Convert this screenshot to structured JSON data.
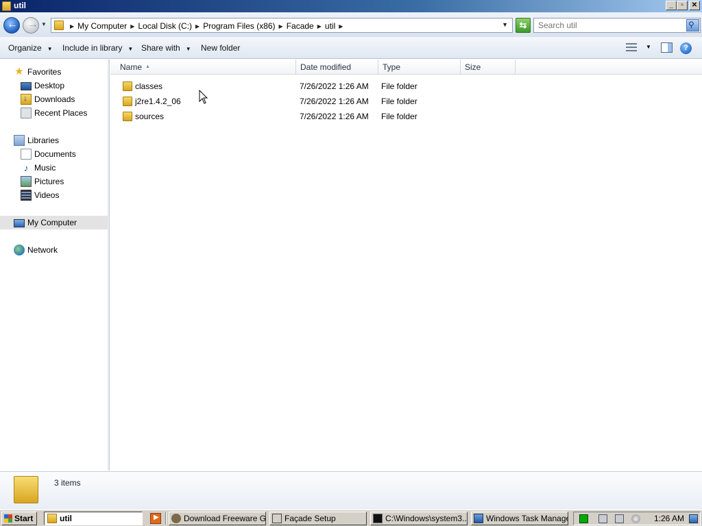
{
  "window": {
    "title": "util",
    "minimize": "_",
    "restore": "▫",
    "close": "✕"
  },
  "address": {
    "breadcrumbs": [
      "My Computer",
      "Local Disk (C:)",
      "Program Files (x86)",
      "Facade",
      "util"
    ],
    "search_placeholder": "Search util"
  },
  "commands": {
    "organize": "Organize",
    "include_in_library": "Include in library",
    "share_with": "Share with",
    "new_folder": "New folder"
  },
  "nav": {
    "favorites": "Favorites",
    "desktop": "Desktop",
    "downloads": "Downloads",
    "recent_places": "Recent Places",
    "libraries": "Libraries",
    "documents": "Documents",
    "music": "Music",
    "pictures": "Pictures",
    "videos": "Videos",
    "my_computer": "My Computer",
    "network": "Network"
  },
  "columns": {
    "name": "Name",
    "date_modified": "Date modified",
    "type": "Type",
    "size": "Size"
  },
  "files": [
    {
      "name": "classes",
      "date": "7/26/2022 1:26 AM",
      "type": "File folder",
      "size": ""
    },
    {
      "name": "j2re1.4.2_06",
      "date": "7/26/2022 1:26 AM",
      "type": "File folder",
      "size": ""
    },
    {
      "name": "sources",
      "date": "7/26/2022 1:26 AM",
      "type": "File folder",
      "size": ""
    }
  ],
  "details": {
    "item_count": "3 items"
  },
  "taskbar": {
    "start": "Start",
    "address_value": "util",
    "tasks": [
      {
        "label": "Download Freeware G...",
        "icon": "browser-icon"
      },
      {
        "label": "Façade Setup",
        "icon": "setup-icon"
      },
      {
        "label": "C:\\Windows\\system3...",
        "icon": "console-icon"
      },
      {
        "label": "Windows Task Manager",
        "icon": "task-manager-icon"
      }
    ],
    "clock": "1:26 AM"
  }
}
